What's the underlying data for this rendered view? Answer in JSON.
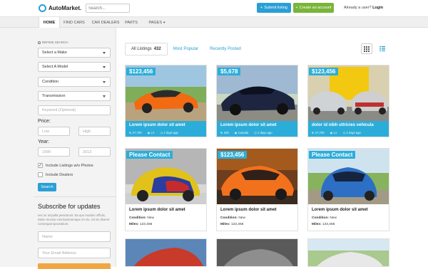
{
  "header": {
    "logo_text": "AutoMarket.",
    "search_placeholder": "Search...",
    "submit_label": "Submit listing",
    "create_label": "Create an account",
    "already_text": "Already a user?",
    "login_label": "Login"
  },
  "nav": {
    "items": [
      {
        "label": "HOME"
      },
      {
        "label": "FIND CARS"
      },
      {
        "label": "CAR DEALERS"
      },
      {
        "label": "PARTS"
      },
      {
        "label": "PAGES"
      }
    ]
  },
  "sidebar": {
    "refine_label": "Refine Search",
    "selects": [
      {
        "label": "Select a Make"
      },
      {
        "label": "Select A Model"
      },
      {
        "label": "Condition"
      },
      {
        "label": "Transmission"
      }
    ],
    "keyword_placeholder": "Keyword (Optional)",
    "price_label": "Price:",
    "price_low": "Low",
    "price_high": "High",
    "year_label": "Year:",
    "year_min": "1990",
    "year_max": "2013",
    "check_photos": "Include Listings w/o Photos",
    "check_dealers": "Include Dealers",
    "search_label": "Search",
    "subscribe_title": "Subscribe for updates",
    "subscribe_text": "nec ac ulcpulla pessimunt. Ea quo modum officiis, tation mucius conclusionemque en vix. Ad vix diceret consequat spooratium.",
    "name_placeholder": "Name",
    "email_placeholder": "Your Email Address"
  },
  "listing": {
    "tab_all": "All Listings",
    "tab_all_count": "432",
    "tab_popular": "Most Popular",
    "tab_recent": "Recently Posted"
  },
  "cards": [
    {
      "price": "$123,456",
      "title": "Lorem ipsum dolor sit amet",
      "miles": "27,700",
      "city": "LA",
      "time": "2 days ago"
    },
    {
      "price": "$5,678",
      "title": "Lorem ipsum dolor sit amet",
      "miles": "200",
      "city": "Canada",
      "time": "2 days ago"
    },
    {
      "price": "$123,456",
      "title": "dolor id nibh ultricies vehicula",
      "miles": "27,700",
      "city": "LA",
      "time": "2 days ago"
    },
    {
      "price": "Please Contact",
      "title": "Lorem ipsum dolor sit amet",
      "condition_label": "Condition:",
      "condition": "New",
      "miles_label": "Miles:",
      "miles": "123,456"
    },
    {
      "price": "$123,456",
      "title": "Lorem ipsum dolor sit amet",
      "condition_label": "Condition:",
      "condition": "New",
      "miles_label": "Miles:",
      "miles": "123,456"
    },
    {
      "price": "Please Contact",
      "title": "Lorem ipsum dolor sit amet",
      "condition_label": "Condition:",
      "condition": "New",
      "miles_label": "Miles:",
      "miles": "123,456"
    }
  ],
  "colors": {
    "accent": "#2a9fd6",
    "green": "#79b53a",
    "card_blue": "#2cadd9"
  }
}
